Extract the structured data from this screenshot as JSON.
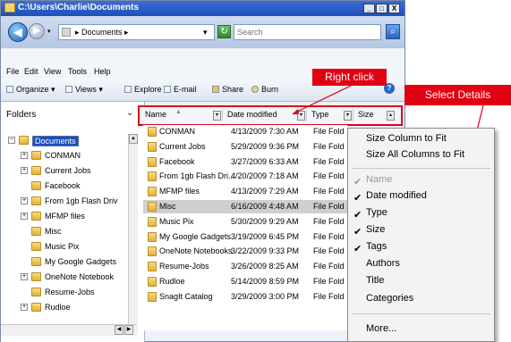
{
  "window": {
    "title": "C:\\Users\\Charlie\\Documents",
    "caption_buttons": [
      "_",
      "□",
      "X"
    ]
  },
  "address": {
    "path": "▸ Documents ▸",
    "search_placeholder": "Search"
  },
  "menu": [
    "File",
    "Edit",
    "View",
    "Tools",
    "Help"
  ],
  "toolbar": [
    {
      "label": "Organize ▾",
      "icon": "organize-icon"
    },
    {
      "label": "Views ▾",
      "icon": "views-icon"
    },
    {
      "label": "Explore",
      "icon": "explore-icon"
    },
    {
      "label": "E-mail",
      "icon": "email-icon"
    },
    {
      "label": "Share",
      "icon": "share-icon"
    },
    {
      "label": "Burn",
      "icon": "burn-icon"
    }
  ],
  "folders": {
    "header": "Folders",
    "items": [
      {
        "label": "Documents",
        "expander": "−",
        "selected": true
      },
      {
        "label": "CONMAN",
        "expander": "+"
      },
      {
        "label": "Current Jobs",
        "expander": "+"
      },
      {
        "label": "Facebook",
        "expander": ""
      },
      {
        "label": "From 1gb Flash Driv",
        "expander": "+"
      },
      {
        "label": "MFMP files",
        "expander": "+"
      },
      {
        "label": "Misc",
        "expander": ""
      },
      {
        "label": "Music Pix",
        "expander": ""
      },
      {
        "label": "My Google Gadgets",
        "expander": ""
      },
      {
        "label": "OneNote Notebook",
        "expander": "+"
      },
      {
        "label": "Resume-Jobs",
        "expander": ""
      },
      {
        "label": "Rudloe",
        "expander": "+"
      }
    ]
  },
  "columns": [
    "Name",
    "Date modified",
    "Type",
    "Size"
  ],
  "files": [
    {
      "name": "CONMAN",
      "date": "4/13/2009 7:30 AM",
      "type": "File Folder"
    },
    {
      "name": "Current Jobs",
      "date": "5/29/2009 9:36 PM",
      "type": "File Folder"
    },
    {
      "name": "Facebook",
      "date": "3/27/2009 6:33 AM",
      "type": "File Folder"
    },
    {
      "name": "From 1gb Flash Dri...",
      "date": "4/20/2009 7:18 AM",
      "type": "File Folder"
    },
    {
      "name": "MFMP files",
      "date": "4/13/2009 7:29 AM",
      "type": "File Folder"
    },
    {
      "name": "Misc",
      "date": "6/16/2009 4:48 AM",
      "type": "File Folder",
      "selected": true
    },
    {
      "name": "Music Pix",
      "date": "5/30/2009 9:29 AM",
      "type": "File Folder"
    },
    {
      "name": "My Google Gadgets",
      "date": "3/19/2009 6:45 PM",
      "type": "File Folder"
    },
    {
      "name": "OneNote Notebooks",
      "date": "3/22/2009 9:33 PM",
      "type": "File Folder"
    },
    {
      "name": "Resume-Jobs",
      "date": "3/26/2009 8:25 AM",
      "type": "File Folder"
    },
    {
      "name": "Rudloe",
      "date": "5/14/2009 8:59 PM",
      "type": "File Folder"
    },
    {
      "name": "SnagIt Catalog",
      "date": "3/29/2009 3:00 PM",
      "type": "File Folder"
    }
  ],
  "context_menu": {
    "items": [
      {
        "label": "Size Column to Fit",
        "checked": false,
        "disabled": false
      },
      {
        "label": "Size All Columns to Fit",
        "checked": false,
        "disabled": false
      },
      {
        "label": "Name",
        "checked": true,
        "disabled": true
      },
      {
        "label": "Date modified",
        "checked": true,
        "disabled": false
      },
      {
        "label": "Type",
        "checked": true,
        "disabled": false
      },
      {
        "label": "Size",
        "checked": true,
        "disabled": false
      },
      {
        "label": "Tags",
        "checked": true,
        "disabled": false
      },
      {
        "label": "Authors",
        "checked": false,
        "disabled": false
      },
      {
        "label": "Title",
        "checked": false,
        "disabled": false
      },
      {
        "label": "Categories",
        "checked": false,
        "disabled": false
      },
      {
        "label": "More...",
        "checked": false,
        "disabled": false
      }
    ]
  },
  "callouts": {
    "right_click": "Right click",
    "select_details": "Select Details"
  },
  "colors": {
    "callout_red": "#e00012",
    "titlebar_blue": "#2a5fc9",
    "selected_row": "#cfcfcf"
  }
}
